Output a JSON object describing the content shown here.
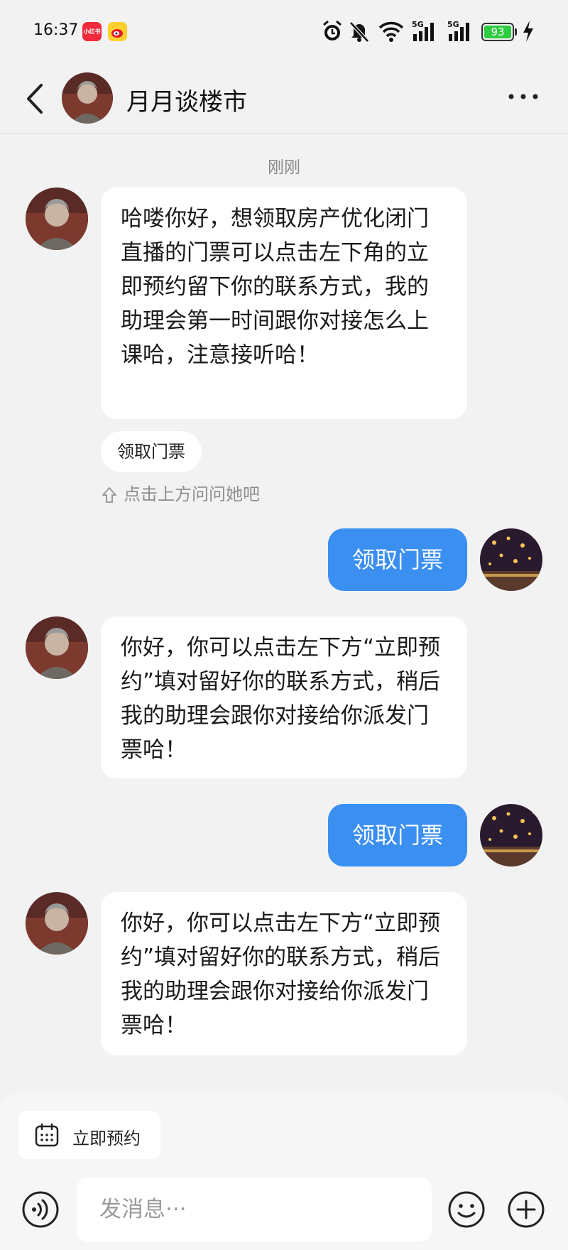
{
  "status_bar": {
    "time": "16:37",
    "app_badge_text": "小红书",
    "battery": "93",
    "icons": [
      "alarm-icon",
      "mute-icon",
      "wifi-icon",
      "signal-5g-icon",
      "signal-5g-icon",
      "charging-icon"
    ]
  },
  "header": {
    "title": "月月谈楼市"
  },
  "chat": {
    "timestamp": "刚刚",
    "messages": [
      {
        "from": "bot",
        "text": "哈喽你好，想领取房产优化闭门直播的门票可以点击左下角的立即预约留下你的联系方式，我的助理会第一时间跟你对接怎么上课哈，注意接听哈！"
      },
      {
        "from": "user",
        "text": "领取门票"
      },
      {
        "from": "bot",
        "text": "你好，你可以点击左下方“立即预约”填对留好你的联系方式，稍后我的助理会跟你对接给你派发门票哈！"
      },
      {
        "from": "user",
        "text": "领取门票"
      },
      {
        "from": "bot",
        "text": "你好，你可以点击左下方“立即预约”填对留好你的联系方式，稍后我的助理会跟你对接给你派发门票哈！"
      }
    ],
    "quick_reply": "领取门票",
    "hint": "点击上方问问她吧"
  },
  "bottom": {
    "reserve_label": "立即预约",
    "input_placeholder": "发消息···"
  },
  "colors": {
    "accent": "#3a8ff0",
    "background": "#f2f2f2",
    "battery": "#2ecc40"
  }
}
